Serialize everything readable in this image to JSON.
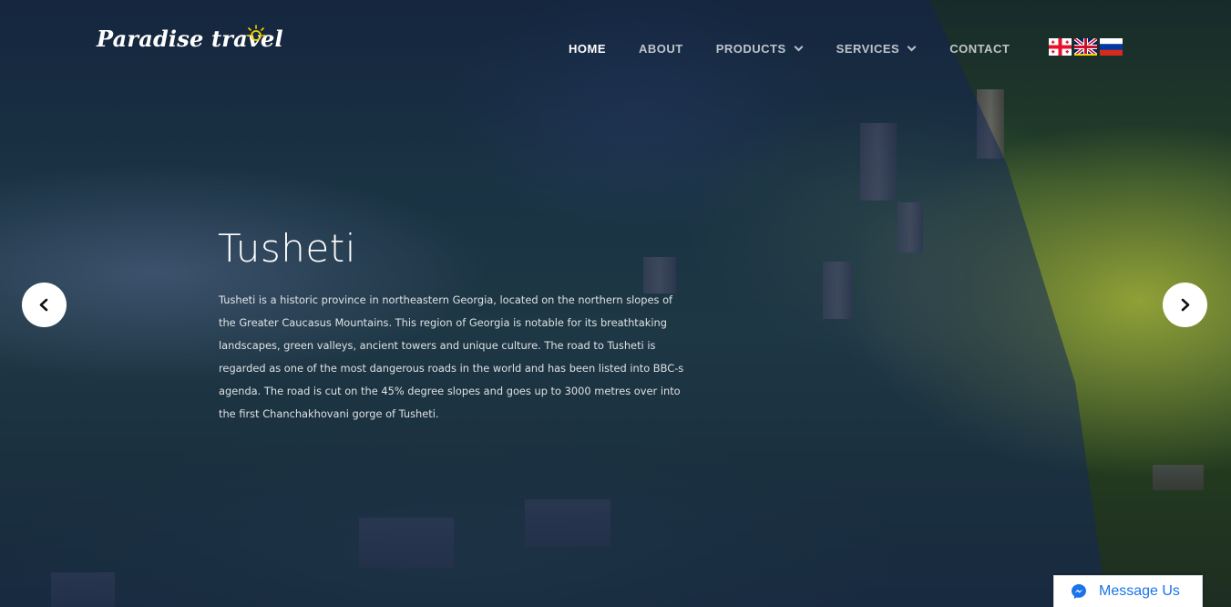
{
  "brand": {
    "logo_text": "Paradise travel"
  },
  "nav": {
    "items": [
      {
        "label": "HOME",
        "active": true,
        "has_dropdown": false
      },
      {
        "label": "ABOUT",
        "active": false,
        "has_dropdown": false
      },
      {
        "label": "PRODUCTS",
        "active": false,
        "has_dropdown": true
      },
      {
        "label": "SERVICES",
        "active": false,
        "has_dropdown": true
      },
      {
        "label": "CONTACT",
        "active": false,
        "has_dropdown": false
      }
    ]
  },
  "languages": [
    {
      "icon": "georgia-flag-icon"
    },
    {
      "icon": "uk-flag-icon"
    },
    {
      "icon": "russia-flag-icon"
    }
  ],
  "slide": {
    "title": "Tusheti",
    "description": "Tusheti is a historic province in northeastern Georgia, located on the northern slopes of the Greater Caucasus Mountains. This region of Georgia is notable for its breathtaking landscapes, green valleys, ancient towers and unique culture. The road to Tusheti is regarded as one of the most dangerous roads in the world and has been listed into BBC-s agenda. The road is cut on the 45% degree slopes and goes up to 3000 metres over into the first Chanchakhovani gorge of Tusheti."
  },
  "slider_controls": {
    "prev_icon": "chevron-left-icon",
    "next_icon": "chevron-right-icon"
  },
  "messenger": {
    "label": "Message Us",
    "color": "#1a73e8"
  },
  "colors": {
    "overlay": "#14285a",
    "text": "#ffffff",
    "logo_sun": "#f5d300"
  }
}
